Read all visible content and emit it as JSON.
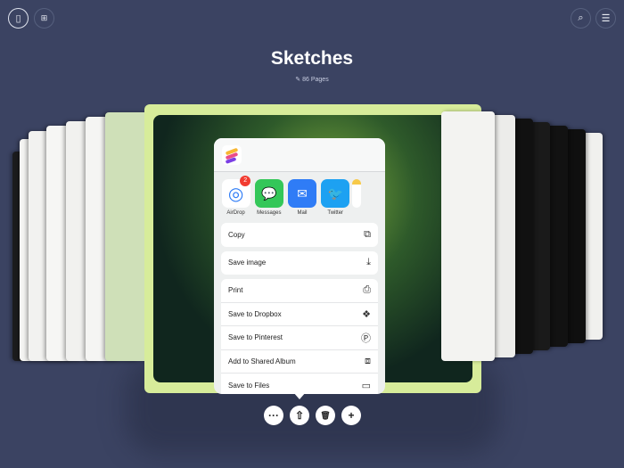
{
  "toolbar": {
    "left": [
      {
        "icon": "book-icon",
        "active": true
      },
      {
        "icon": "grid-icon",
        "active": false
      }
    ],
    "right": [
      {
        "icon": "search-icon"
      },
      {
        "icon": "menu-icon"
      }
    ]
  },
  "header": {
    "title": "Sketches",
    "pages": "86 Pages",
    "pages_icon": "pencil-slash-icon"
  },
  "share_sheet": {
    "apps": [
      {
        "label": "AirDrop",
        "icon": "airdrop-icon",
        "badge": "2",
        "color": "#ffffff"
      },
      {
        "label": "Messages",
        "icon": "messages-icon",
        "color": "#34c759"
      },
      {
        "label": "Mail",
        "icon": "mail-icon",
        "color": "#2f7cf6"
      },
      {
        "label": "Twitter",
        "icon": "twitter-icon",
        "color": "#1da1f2"
      }
    ],
    "actions": [
      {
        "label": "Copy",
        "icon": "copy-icon"
      },
      {
        "label": "Save image",
        "icon": "save-icon"
      },
      {
        "label": "Print",
        "icon": "print-icon"
      },
      {
        "label": "Save to Dropbox",
        "icon": "dropbox-icon"
      },
      {
        "label": "Save to Pinterest",
        "icon": "pinterest-icon"
      },
      {
        "label": "Add to Shared Album",
        "icon": "shared-album-icon"
      },
      {
        "label": "Save to Files",
        "icon": "folder-icon"
      }
    ]
  },
  "bottom_actions": [
    {
      "icon": "more-icon",
      "glyph": "···"
    },
    {
      "icon": "share-icon",
      "glyph": "⇧"
    },
    {
      "icon": "trash-icon",
      "glyph": "🗑"
    },
    {
      "icon": "add-icon",
      "glyph": "+"
    }
  ]
}
